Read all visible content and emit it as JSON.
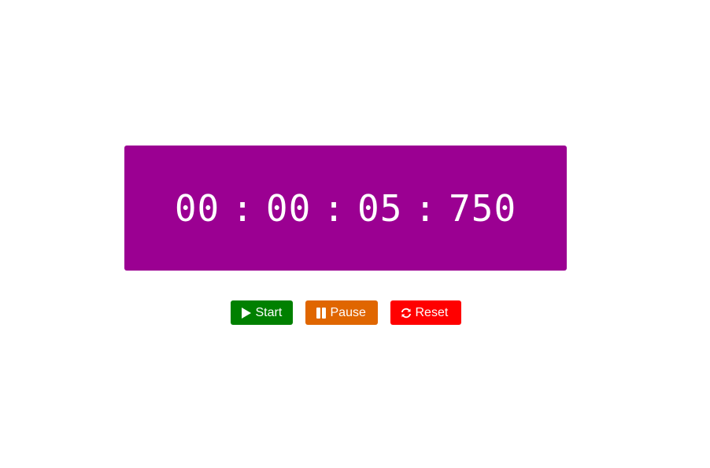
{
  "timer": {
    "hours": "00",
    "minutes": "00",
    "seconds": "05",
    "milliseconds": "750",
    "separator": ":"
  },
  "controls": {
    "start_label": "Start",
    "pause_label": "Pause",
    "reset_label": "Reset"
  },
  "icons": {
    "start": "play-icon",
    "pause": "pause-icon",
    "reset": "refresh-icon"
  },
  "colors": {
    "display_bg": "#9b0092",
    "start": "#008000",
    "pause": "#e06600",
    "reset": "#ff0000"
  }
}
